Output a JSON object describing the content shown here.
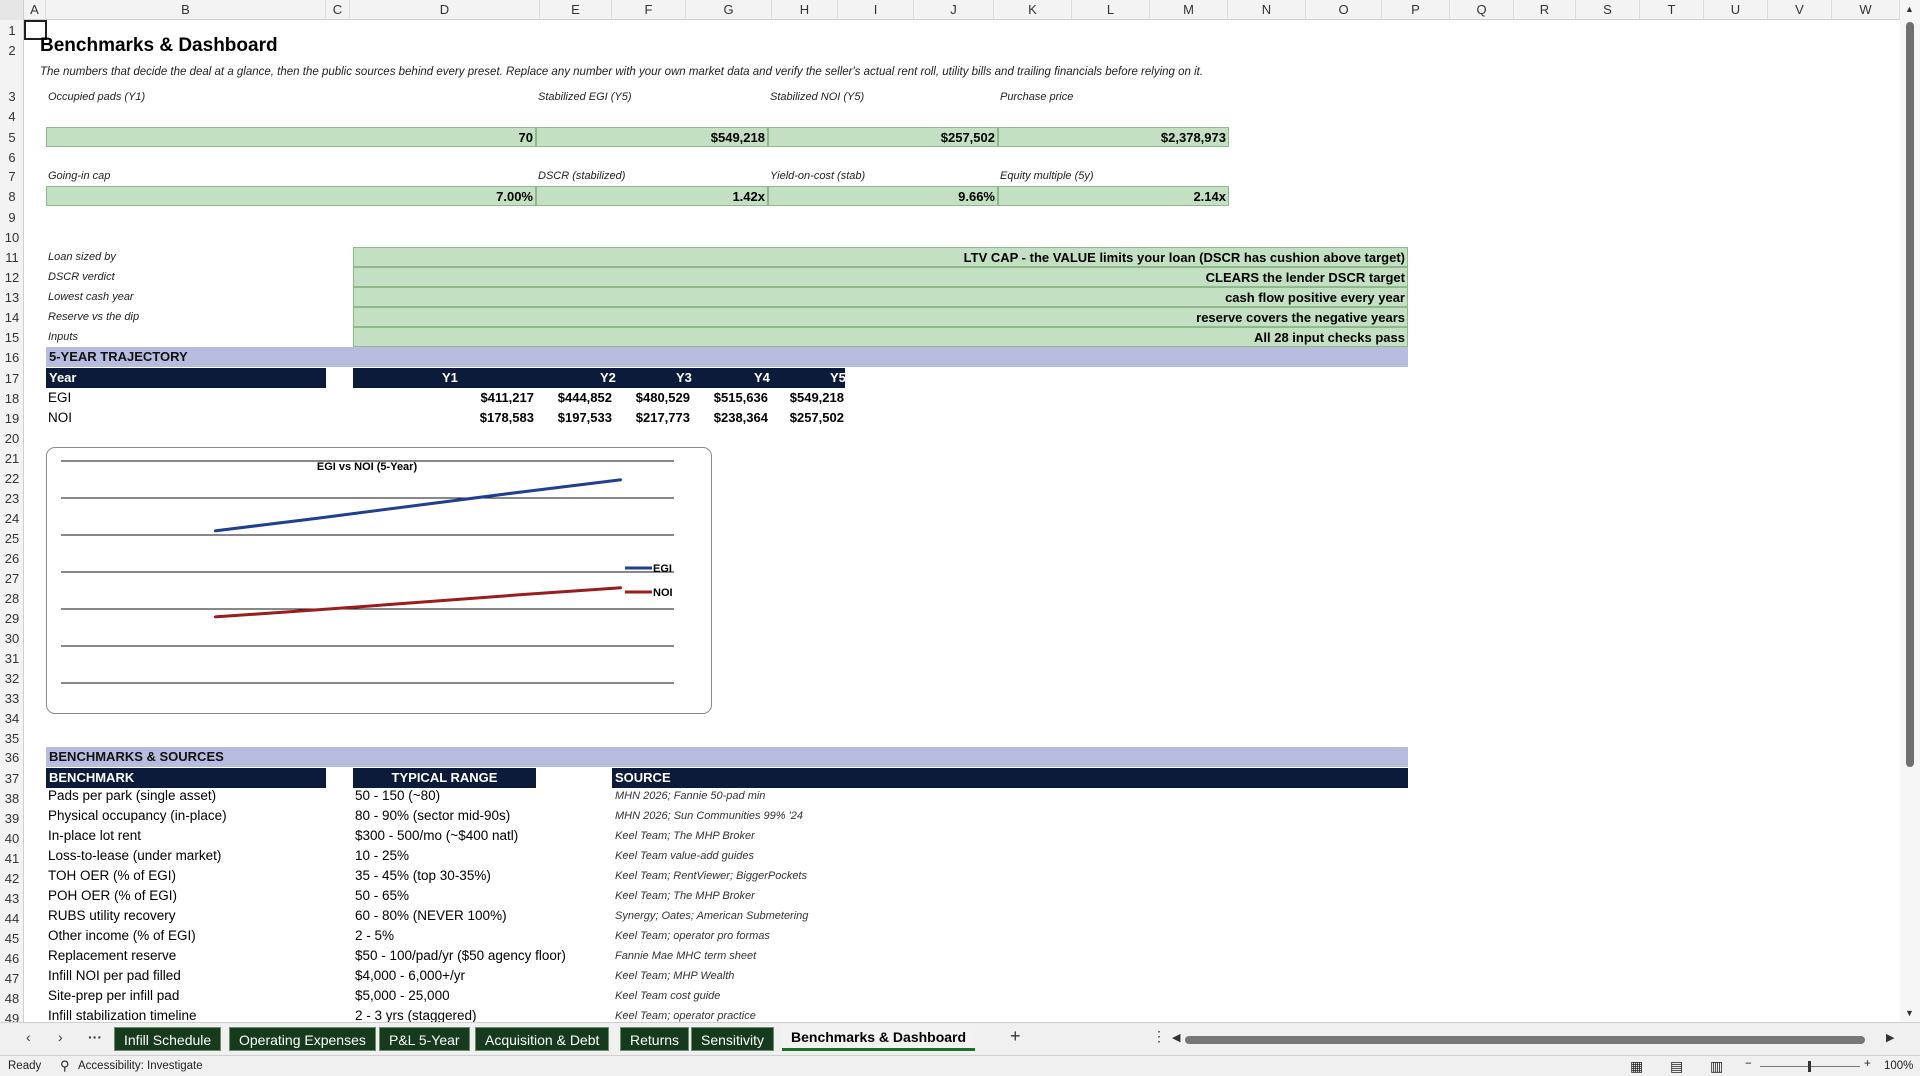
{
  "columns": [
    "A",
    "B",
    "C",
    "D",
    "E",
    "F",
    "G",
    "H",
    "I",
    "J",
    "K",
    "L",
    "M",
    "N",
    "O",
    "P",
    "Q",
    "R",
    "S",
    "T",
    "U",
    "V",
    "W"
  ],
  "rows": [
    "1",
    "2",
    "3",
    "4",
    "5",
    "6",
    "7",
    "8",
    "9",
    "10",
    "11",
    "12",
    "13",
    "14",
    "15",
    "16",
    "17",
    "18",
    "19",
    "20",
    "21",
    "22",
    "23",
    "24",
    "25",
    "26",
    "27",
    "28",
    "29",
    "30",
    "31",
    "32",
    "33",
    "34",
    "35",
    "36",
    "37",
    "38",
    "39",
    "40",
    "41",
    "42",
    "43",
    "44",
    "45",
    "46",
    "47",
    "48",
    "49"
  ],
  "sheet": {
    "title": "Benchmarks & Dashboard",
    "subtitle": "The numbers that decide the deal at a glance, then the public sources behind every preset. Replace any number with your own market data and verify the seller's actual rent roll, utility bills and trailing financials before relying on it.",
    "kpis_row1": [
      {
        "label": "Occupied pads (Y1)",
        "value": "70"
      },
      {
        "label": "Stabilized EGI (Y5)",
        "value": "$549,218"
      },
      {
        "label": "Stabilized NOI (Y5)",
        "value": "$257,502"
      },
      {
        "label": "Purchase price",
        "value": "$2,378,973"
      }
    ],
    "kpis_row2": [
      {
        "label": "Going-in cap",
        "value": "7.00%"
      },
      {
        "label": "DSCR (stabilized)",
        "value": "1.42x"
      },
      {
        "label": "Yield-on-cost (stab)",
        "value": "9.66%"
      },
      {
        "label": "Equity multiple (5y)",
        "value": "2.14x"
      }
    ],
    "verdicts": [
      {
        "label": "Loan sized by",
        "value": "LTV CAP - the VALUE limits your loan (DSCR has cushion above target)"
      },
      {
        "label": "DSCR verdict",
        "value": "CLEARS the lender DSCR target"
      },
      {
        "label": "Lowest cash year",
        "value": "cash flow positive every year"
      },
      {
        "label": "Reserve vs the dip",
        "value": "reserve covers the negative years"
      },
      {
        "label": "Inputs",
        "value": "All 28 input checks pass"
      }
    ],
    "trajectory": {
      "section": "5-YEAR TRAJECTORY",
      "year_label": "Year",
      "years": [
        "Y1",
        "Y2",
        "Y3",
        "Y4",
        "Y5"
      ],
      "rows": [
        {
          "label": "EGI",
          "values": [
            "$411,217",
            "$444,852",
            "$480,529",
            "$515,636",
            "$549,218"
          ]
        },
        {
          "label": "NOI",
          "values": [
            "$178,583",
            "$197,533",
            "$217,773",
            "$238,364",
            "$257,502"
          ]
        }
      ]
    },
    "benchmarks": {
      "section": "BENCHMARKS & SOURCES",
      "headers": [
        "BENCHMARK",
        "TYPICAL RANGE",
        "SOURCE"
      ],
      "rows": [
        {
          "benchmark": "Pads per park (single asset)",
          "range": "50 - 150 (~80)",
          "source": "MHN 2026; Fannie 50-pad min"
        },
        {
          "benchmark": "Physical occupancy (in-place)",
          "range": "80 - 90% (sector mid-90s)",
          "source": "MHN 2026; Sun Communities 99% '24"
        },
        {
          "benchmark": "In-place lot rent",
          "range": "$300 - 500/mo (~$400 natl)",
          "source": "Keel Team; The MHP Broker"
        },
        {
          "benchmark": "Loss-to-lease (under market)",
          "range": "10 - 25%",
          "source": "Keel Team value-add guides"
        },
        {
          "benchmark": "TOH OER (% of EGI)",
          "range": "35 - 45% (top 30-35%)",
          "source": "Keel Team; RentViewer; BiggerPockets"
        },
        {
          "benchmark": "POH OER (% of EGI)",
          "range": "50 - 65%",
          "source": "Keel Team; The MHP Broker"
        },
        {
          "benchmark": "RUBS utility recovery",
          "range": "60 - 80% (NEVER 100%)",
          "source": "Synergy; Oates; American Submetering"
        },
        {
          "benchmark": "Other income (% of EGI)",
          "range": "2 - 5%",
          "source": "Keel Team; operator pro formas"
        },
        {
          "benchmark": "Replacement reserve",
          "range": "$50 - 100/pad/yr ($50 agency floor)",
          "source": "Fannie Mae MHC term sheet"
        },
        {
          "benchmark": "Infill NOI per pad filled",
          "range": "$4,000 - 6,000+/yr",
          "source": "Keel Team; MHP Wealth"
        },
        {
          "benchmark": "Site-prep per infill pad",
          "range": "$5,000 - 25,000",
          "source": "Keel Team cost guide"
        },
        {
          "benchmark": "Infill stabilization timeline",
          "range": "2 - 3 yrs (staggered)",
          "source": "Keel Team; operator practice"
        }
      ]
    }
  },
  "chart_data": {
    "type": "line",
    "title": "EGI vs NOI (5-Year)",
    "categories": [
      "Y1",
      "Y2",
      "Y3",
      "Y4",
      "Y5"
    ],
    "series": [
      {
        "name": "EGI",
        "values": [
          411217,
          444852,
          480529,
          515636,
          549218
        ],
        "color": "#1f3f8f"
      },
      {
        "name": "NOI",
        "values": [
          178583,
          197533,
          217773,
          238364,
          257502
        ],
        "color": "#9b1c1c"
      }
    ],
    "ylim": [
      0,
      600000
    ],
    "grid": true,
    "legend": "right"
  },
  "tabs": {
    "items": [
      "Infill Schedule",
      "Operating Expenses",
      "P&L 5-Year",
      "Acquisition & Debt",
      "Returns",
      "Sensitivity",
      "Benchmarks & Dashboard"
    ],
    "add": "+",
    "more": "···",
    "prev": "‹",
    "next": "›"
  },
  "status": {
    "ready": "Ready",
    "accessibility": "Accessibility: Investigate",
    "zoom": "100%"
  },
  "colors": {
    "kpi_fill": "#c4e0c2",
    "section_fill": "#b8bde0",
    "header_fill": "#0d1b3a"
  }
}
